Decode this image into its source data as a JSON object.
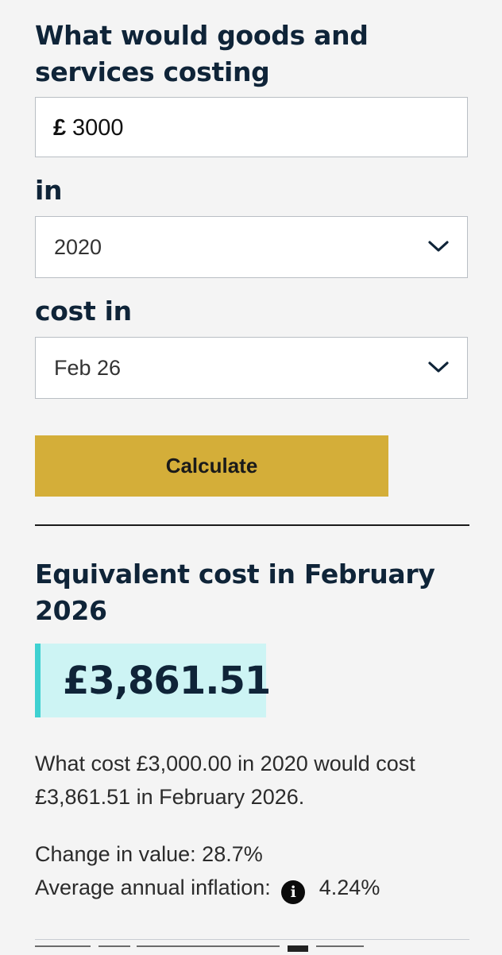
{
  "form": {
    "question": "What would goods and services costing",
    "currency_symbol": "£",
    "amount_value": "3000",
    "in_label": "in",
    "from_year": "2020",
    "cost_in_label": "cost in",
    "to_date": "Feb 26",
    "calculate_label": "Calculate"
  },
  "result": {
    "title": "Equivalent cost in February 2026",
    "value": "£3,861.51",
    "summary": "What cost £3,000.00 in 2020 would cost £3,861.51 in February 2026.",
    "change_label": "Change in value:",
    "change_value": "28.7%",
    "inflation_label": "Average annual inflation:",
    "inflation_value": "4.24%",
    "info_glyph": "i"
  },
  "icons": {
    "select_arrow": "chevron-down-icon",
    "info": "info-icon"
  },
  "colors": {
    "heading": "#0f2438",
    "button": "#d4ae39",
    "result_bg": "#cdf4f4",
    "result_accent": "#3fd1d1",
    "page_bg": "#f4f4f4"
  }
}
